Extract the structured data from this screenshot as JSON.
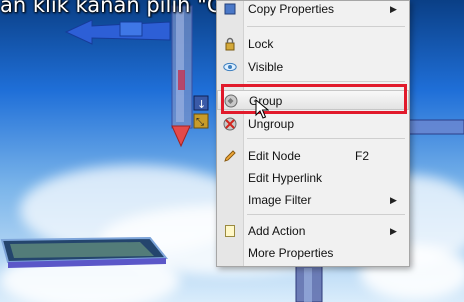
{
  "caption": {
    "text": "an klik kanan pilih \"Group\"."
  },
  "context_menu": {
    "items": [
      {
        "label": "Copy Properties",
        "shortcut": "",
        "submenu": true,
        "icon": "copy-properties-icon"
      },
      {
        "label": "Lock",
        "shortcut": "",
        "submenu": false,
        "icon": "lock-icon"
      },
      {
        "label": "Visible",
        "shortcut": "",
        "submenu": false,
        "icon": "eye-icon"
      },
      {
        "label": "Group",
        "shortcut": "",
        "submenu": false,
        "icon": "group-icon",
        "highlighted": true
      },
      {
        "label": "Ungroup",
        "shortcut": "",
        "submenu": false,
        "icon": "ungroup-icon"
      },
      {
        "label": "Edit Node",
        "shortcut": "F2",
        "submenu": false,
        "icon": "pencil-icon"
      },
      {
        "label": "Edit Hyperlink",
        "shortcut": "",
        "submenu": false,
        "icon": ""
      },
      {
        "label": "Image Filter",
        "shortcut": "",
        "submenu": true,
        "icon": ""
      },
      {
        "label": "Add Action",
        "shortcut": "",
        "submenu": true,
        "icon": "add-action-icon"
      },
      {
        "label": "More Properties",
        "shortcut": "",
        "submenu": false,
        "icon": ""
      }
    ]
  },
  "highlight": {
    "color": "#e11a2b",
    "target": "Group"
  },
  "scene": {
    "sky_top": "#0a3f86",
    "sky_bottom": "#d9ecfb",
    "gizmo_blue": "#2d5fd6",
    "gizmo_red": "#e44a4a"
  }
}
